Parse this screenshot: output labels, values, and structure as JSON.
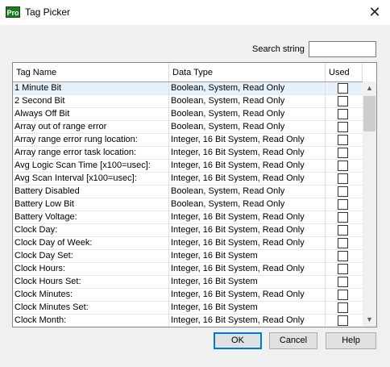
{
  "window": {
    "title": "Tag Picker",
    "icon": "Pro",
    "close_glyph": "✕"
  },
  "search": {
    "label": "Search string",
    "value": ""
  },
  "table": {
    "columns": [
      "Tag Name",
      "Data Type",
      "Used"
    ],
    "rows": [
      {
        "name": "1 Minute Bit",
        "type": "Boolean, System, Read Only",
        "used": false
      },
      {
        "name": "2 Second Bit",
        "type": "Boolean, System, Read Only",
        "used": false
      },
      {
        "name": "Always Off Bit",
        "type": "Boolean, System, Read Only",
        "used": false
      },
      {
        "name": "Array out of range error",
        "type": "Boolean, System, Read Only",
        "used": false
      },
      {
        "name": "Array range error rung location:",
        "type": "Integer, 16 Bit System, Read Only",
        "used": false
      },
      {
        "name": "Array range error task location:",
        "type": "Integer, 16 Bit System, Read Only",
        "used": false
      },
      {
        "name": "Avg Logic Scan Time [x100=usec]:",
        "type": "Integer, 16 Bit System, Read Only",
        "used": false
      },
      {
        "name": "Avg Scan Interval [x100=usec]:",
        "type": "Integer, 16 Bit System, Read Only",
        "used": false
      },
      {
        "name": "Battery Disabled",
        "type": "Boolean, System, Read Only",
        "used": false
      },
      {
        "name": "Battery Low Bit",
        "type": "Boolean, System, Read Only",
        "used": false
      },
      {
        "name": "Battery Voltage:",
        "type": "Integer, 16 Bit System, Read Only",
        "used": false
      },
      {
        "name": "Clock Day:",
        "type": "Integer, 16 Bit System, Read Only",
        "used": false
      },
      {
        "name": "Clock Day of Week:",
        "type": "Integer, 16 Bit System, Read Only",
        "used": false
      },
      {
        "name": "Clock Day Set:",
        "type": "Integer, 16 Bit System",
        "used": false
      },
      {
        "name": "Clock Hours:",
        "type": "Integer, 16 Bit System, Read Only",
        "used": false
      },
      {
        "name": "Clock Hours Set:",
        "type": "Integer, 16 Bit System",
        "used": false
      },
      {
        "name": "Clock Minutes:",
        "type": "Integer, 16 Bit System, Read Only",
        "used": false
      },
      {
        "name": "Clock Minutes Set:",
        "type": "Integer, 16 Bit System",
        "used": false
      },
      {
        "name": "Clock Month:",
        "type": "Integer, 16 Bit System, Read Only",
        "used": false
      }
    ]
  },
  "buttons": {
    "ok": "OK",
    "cancel": "Cancel",
    "help": "Help"
  },
  "scrollbar": {
    "up_glyph": "▲",
    "down_glyph": "▼"
  }
}
